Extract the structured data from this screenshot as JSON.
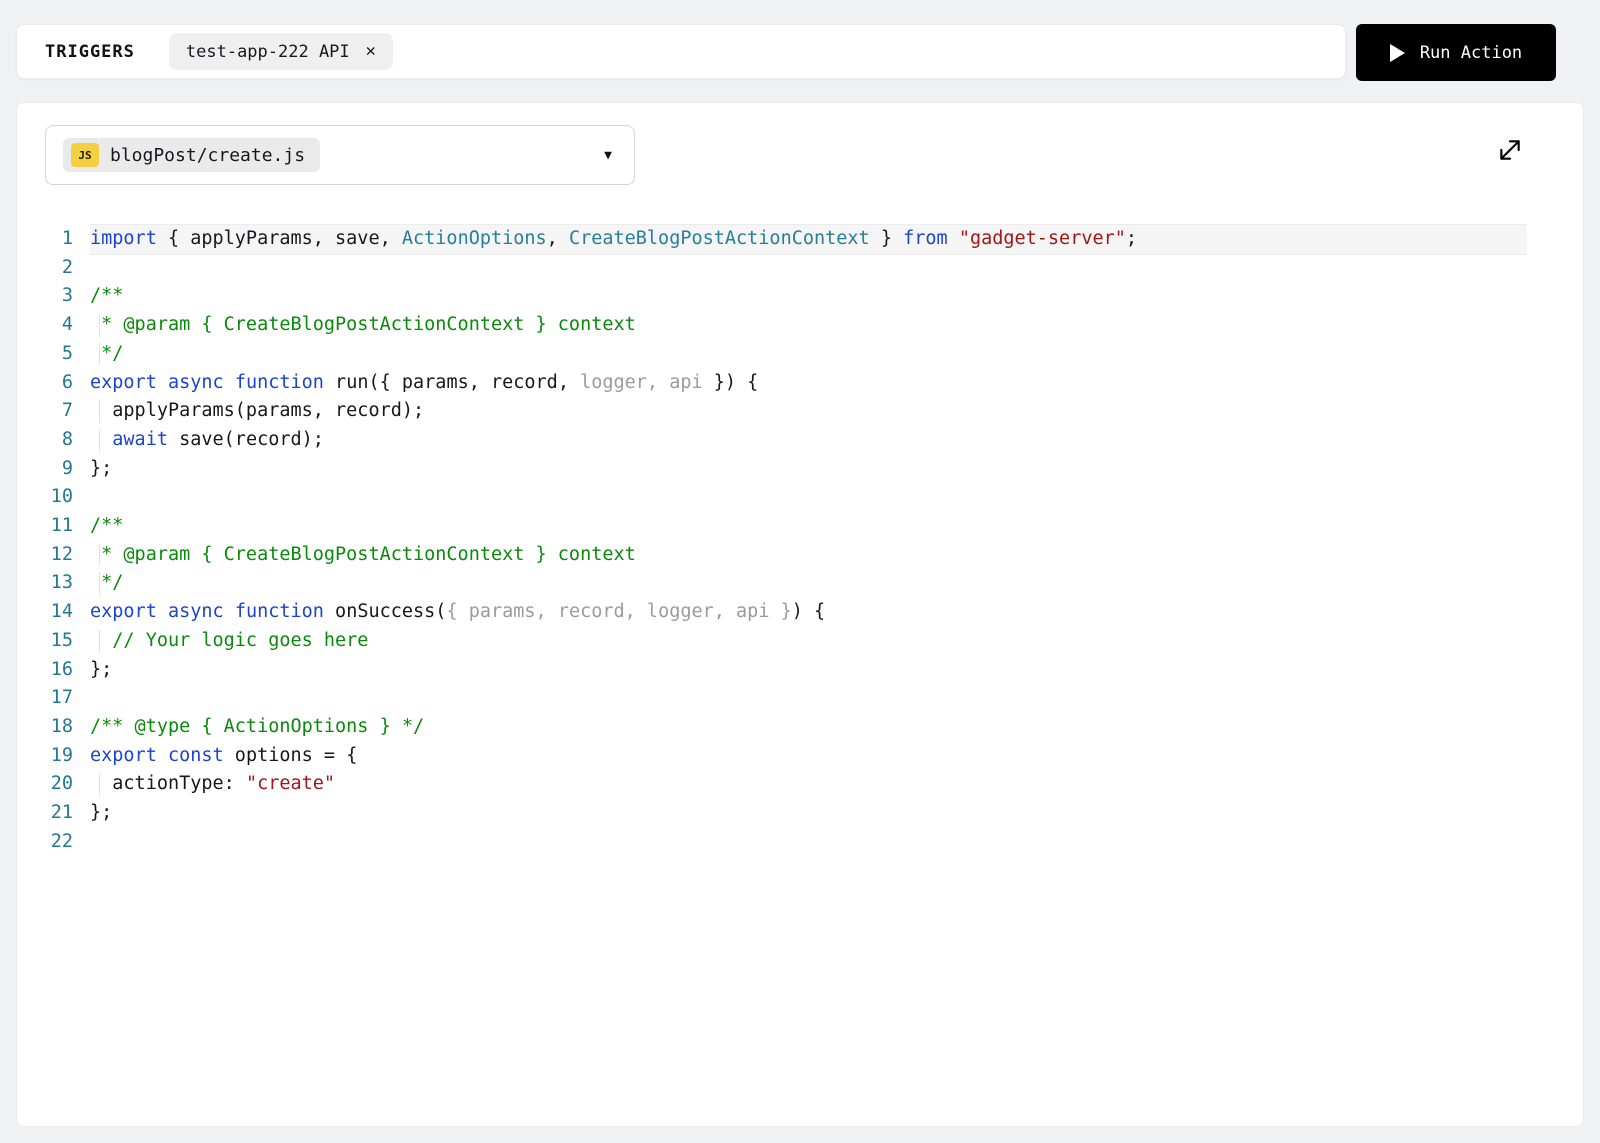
{
  "colors": {
    "page_bg": "#f0f1f2",
    "keyword": "#1b44d0",
    "type": "#267f99",
    "string": "#a31515",
    "comment": "#0a8a0a",
    "dim": "#9b9b9b",
    "default_text": "#17181c",
    "line_number": "#237893",
    "js_badge_bg": "#f2d03f",
    "run_button_bg": "#000000"
  },
  "icons": {
    "close": "✕",
    "chevron_down": "▼",
    "play": "play-triangle",
    "expand": "diagonal-expand-arrows"
  },
  "header": {
    "triggers_label": "TRIGGERS",
    "chip": {
      "label": "test-app-222 API"
    },
    "run_button": {
      "label": "Run Action"
    }
  },
  "file_selector": {
    "badge": "JS",
    "filename": "blogPost/create.js"
  },
  "code": {
    "language": "javascript",
    "active_line": 1,
    "lines": [
      {
        "n": 1,
        "t": [
          [
            "kw",
            "import"
          ],
          [
            "d",
            " { applyParams, save, "
          ],
          [
            "ty",
            "ActionOptions"
          ],
          [
            "d",
            ", "
          ],
          [
            "ty",
            "CreateBlogPostActionContext"
          ],
          [
            "d",
            " } "
          ],
          [
            "kw",
            "from"
          ],
          [
            "d",
            " "
          ],
          [
            "st",
            "\"gadget-server\""
          ],
          [
            "d",
            ";"
          ]
        ]
      },
      {
        "n": 2,
        "t": []
      },
      {
        "n": 3,
        "t": [
          [
            "cm",
            "/**"
          ]
        ]
      },
      {
        "n": 4,
        "g": true,
        "t": [
          [
            "cm",
            " * @param { CreateBlogPostActionContext } context"
          ]
        ]
      },
      {
        "n": 5,
        "g": true,
        "t": [
          [
            "cm",
            " */"
          ]
        ]
      },
      {
        "n": 6,
        "t": [
          [
            "kw",
            "export"
          ],
          [
            "d",
            " "
          ],
          [
            "kw",
            "async"
          ],
          [
            "d",
            " "
          ],
          [
            "kw",
            "function"
          ],
          [
            "d",
            " run({ params, record,"
          ],
          [
            "dim",
            " logger, api"
          ],
          [
            "d",
            " }) {"
          ]
        ]
      },
      {
        "n": 7,
        "g": true,
        "t": [
          [
            "d",
            "  applyParams(params, record);"
          ]
        ]
      },
      {
        "n": 8,
        "g": true,
        "t": [
          [
            "d",
            "  "
          ],
          [
            "kw",
            "await"
          ],
          [
            "d",
            " save(record);"
          ]
        ]
      },
      {
        "n": 9,
        "t": [
          [
            "d",
            "};"
          ]
        ]
      },
      {
        "n": 10,
        "t": []
      },
      {
        "n": 11,
        "t": [
          [
            "cm",
            "/**"
          ]
        ]
      },
      {
        "n": 12,
        "g": true,
        "t": [
          [
            "cm",
            " * @param { CreateBlogPostActionContext } context"
          ]
        ]
      },
      {
        "n": 13,
        "g": true,
        "t": [
          [
            "cm",
            " */"
          ]
        ]
      },
      {
        "n": 14,
        "t": [
          [
            "kw",
            "export"
          ],
          [
            "d",
            " "
          ],
          [
            "kw",
            "async"
          ],
          [
            "d",
            " "
          ],
          [
            "kw",
            "function"
          ],
          [
            "d",
            " onSuccess("
          ],
          [
            "dim",
            "{ params, record, logger, api }"
          ],
          [
            "d",
            ") {"
          ]
        ]
      },
      {
        "n": 15,
        "g": true,
        "t": [
          [
            "cm",
            "  // Your logic goes here"
          ]
        ]
      },
      {
        "n": 16,
        "t": [
          [
            "d",
            "};"
          ]
        ]
      },
      {
        "n": 17,
        "t": []
      },
      {
        "n": 18,
        "t": [
          [
            "cm",
            "/** @type { ActionOptions } */"
          ]
        ]
      },
      {
        "n": 19,
        "t": [
          [
            "kw",
            "export"
          ],
          [
            "d",
            " "
          ],
          [
            "kw",
            "const"
          ],
          [
            "d",
            " options = {"
          ]
        ]
      },
      {
        "n": 20,
        "g": true,
        "t": [
          [
            "d",
            "  actionType: "
          ],
          [
            "st",
            "\"create\""
          ]
        ]
      },
      {
        "n": 21,
        "t": [
          [
            "d",
            "};"
          ]
        ]
      },
      {
        "n": 22,
        "t": []
      }
    ]
  }
}
